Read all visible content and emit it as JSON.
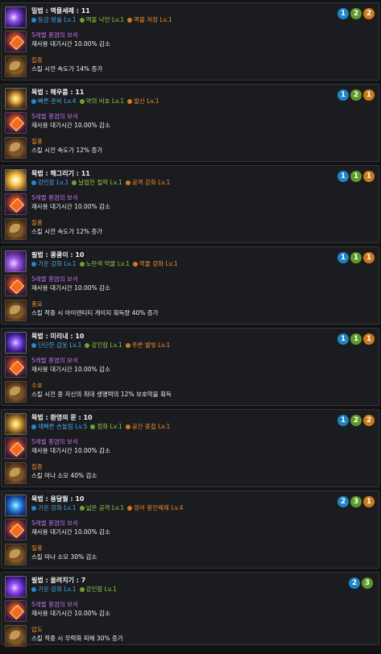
{
  "cards": [
    {
      "title": "밀법 : 멱몰세례 : 11",
      "tripods": [
        {
          "label": "등금 방울 Lv.1",
          "color": "blue"
        },
        {
          "label": "멱몰 낙인 Lv.1",
          "color": "green"
        },
        {
          "label": "멱몰 저장 Lv.1",
          "color": "orange"
        }
      ],
      "gem_name": "5레벨 홍염의 보석",
      "gem_effect": "재사용 대기시간 10.00% 감소",
      "rune_name": "집중",
      "rune_effect": "스킬 시전 속도가 14% 증가",
      "badges": [
        "1",
        "2",
        "2"
      ]
    },
    {
      "title": "목법 : 해우를 : 11",
      "tripods": [
        {
          "label": "빠른 준비 Lv.4",
          "color": "blue"
        },
        {
          "label": "약의 비호 Lv.1",
          "color": "green"
        },
        {
          "label": "발산 Lv.1",
          "color": "orange"
        }
      ],
      "gem_name": "5레벨 홍염의 보석",
      "gem_effect": "재사용 대기시간 10.00% 감소",
      "rune_name": "질풍",
      "rune_effect": "스킬 시전 속도가 12% 증가",
      "badges": [
        "1",
        "2",
        "1"
      ]
    },
    {
      "title": "묵법 : 해그리기 : 11",
      "tripods": [
        {
          "label": "강인함 Lv.1",
          "color": "blue"
        },
        {
          "label": "날렵한 필력 Lv.1",
          "color": "green"
        },
        {
          "label": "공격 강화 Lv.1",
          "color": "orange"
        }
      ],
      "gem_name": "5레벨 홍염의 보석",
      "gem_effect": "재사용 대기시간 10.00% 감소",
      "rune_name": "질풍",
      "rune_effect": "스킬 시전 속도가 12% 증가",
      "badges": [
        "1",
        "1",
        "1"
      ]
    },
    {
      "title": "필법 : 콩콩이 : 10",
      "tripods": [
        {
          "label": "기운 강화 Lv.1",
          "color": "blue"
        },
        {
          "label": "노란색 먹물 Lv.1",
          "color": "green"
        },
        {
          "label": "먹물 강화 Lv.1",
          "color": "orange"
        }
      ],
      "gem_name": "5레벨 홍염의 보석",
      "gem_effect": "재사용 대기시간 10.00% 감소",
      "rune_name": "풍요",
      "rune_effect": "스킬 적중 시 아이덴티티 게이지 획득량 40% 증가",
      "badges": [
        "1",
        "1",
        "1"
      ]
    },
    {
      "title": "묵법 : 미리내 : 10",
      "tripods": [
        {
          "label": "단단한 갑옷 Lv.1",
          "color": "blue"
        },
        {
          "label": "강인함 Lv.1",
          "color": "green"
        },
        {
          "label": "푸른 별빛 Lv.1",
          "color": "orange"
        }
      ],
      "gem_name": "5레벨 홍염의 보석",
      "gem_effect": "재사용 대기시간 10.00% 감소",
      "rune_name": "수호",
      "rune_effect": "스킬 시전 중 자신의 최대 생명력의 12% 보호막을 획득",
      "badges": [
        "1",
        "1",
        "1"
      ]
    },
    {
      "title": "묵법 : 환영의 문 : 10",
      "tripods": [
        {
          "label": "재빠른 손놀림 Lv.5",
          "color": "blue"
        },
        {
          "label": "정화 Lv.1",
          "color": "green"
        },
        {
          "label": "공간 중첩 Lv.1",
          "color": "orange"
        }
      ],
      "gem_name": "5레벨 홍염의 보석",
      "gem_effect": "재사용 대기시간 10.00% 감소",
      "rune_name": "집중",
      "rune_effect": "스킬 마나 소모 40% 감소",
      "badges": [
        "1",
        "2",
        "2"
      ]
    },
    {
      "title": "묵법 : 용달월 : 10",
      "tripods": [
        {
          "label": "기운 강화 Lv.1",
          "color": "blue"
        },
        {
          "label": "넓은 공격 Lv.1",
          "color": "green"
        },
        {
          "label": "잉어 봉인해제 Lv.4",
          "color": "orange"
        }
      ],
      "gem_name": "5레벨 홍염의 보석",
      "gem_effect": "재사용 대기시간 10.00% 감소",
      "rune_name": "질풍",
      "rune_effect": "스킬 마나 소모 30% 감소",
      "badges": [
        "2",
        "3",
        "1"
      ]
    },
    {
      "title": "필법 : 올려치기 : 7",
      "tripods": [
        {
          "label": "기운 강화 Lv.1",
          "color": "blue"
        },
        {
          "label": "강인함 Lv.1",
          "color": "green"
        }
      ],
      "gem_name": "5레벨 홍염의 보석",
      "gem_effect": "재사용 대기시간 10.00% 감소",
      "rune_name": "압도",
      "rune_effect": "스킬 적중 시 무력화 피해 30% 증가",
      "badges": [
        "2",
        "3"
      ]
    }
  ]
}
